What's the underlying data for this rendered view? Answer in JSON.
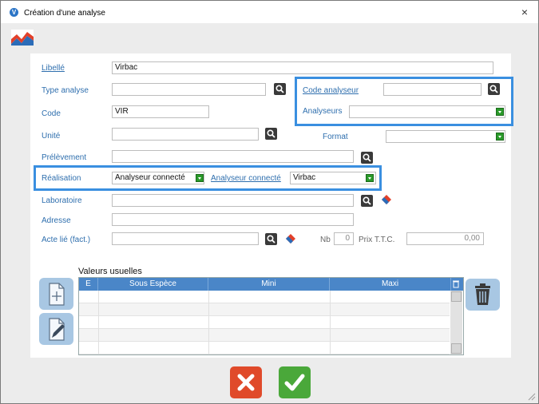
{
  "window": {
    "title": "Création d'une analyse",
    "close_glyph": "×",
    "app_icon": "V"
  },
  "form": {
    "libelle": {
      "label": "Libellé",
      "value": "Virbac"
    },
    "type_analyse": {
      "label": "Type analyse",
      "value": ""
    },
    "code_analyseur": {
      "label": "Code analyseur",
      "value": ""
    },
    "code": {
      "label": "Code",
      "value": "VIR"
    },
    "analyseurs": {
      "label": "Analyseurs",
      "value": ""
    },
    "unite": {
      "label": "Unité",
      "value": ""
    },
    "format": {
      "label": "Format",
      "value": ""
    },
    "prelevement": {
      "label": "Prélèvement",
      "value": ""
    },
    "realisation": {
      "label": "Réalisation",
      "value": "Analyseur connecté"
    },
    "analyseur_connecte": {
      "label": "Analyseur connecté",
      "value": "Virbac"
    },
    "laboratoire": {
      "label": "Laboratoire",
      "value": ""
    },
    "adresse": {
      "label": "Adresse",
      "value": ""
    },
    "acte_lie": {
      "label": "Acte lié (fact.)",
      "value": ""
    },
    "nb": {
      "label": "Nb",
      "value": "0"
    },
    "prix": {
      "label": "Prix T.T.C.",
      "value": "0,00"
    }
  },
  "valeurs": {
    "title": "Valeurs usuelles",
    "columns": [
      "E",
      "Sous Espèce",
      "Mini",
      "Maxi"
    ]
  },
  "colors": {
    "accent": "#4a86c8",
    "highlight": "#3a8fe0",
    "cancel": "#e04a2a",
    "ok": "#4aa83a"
  }
}
